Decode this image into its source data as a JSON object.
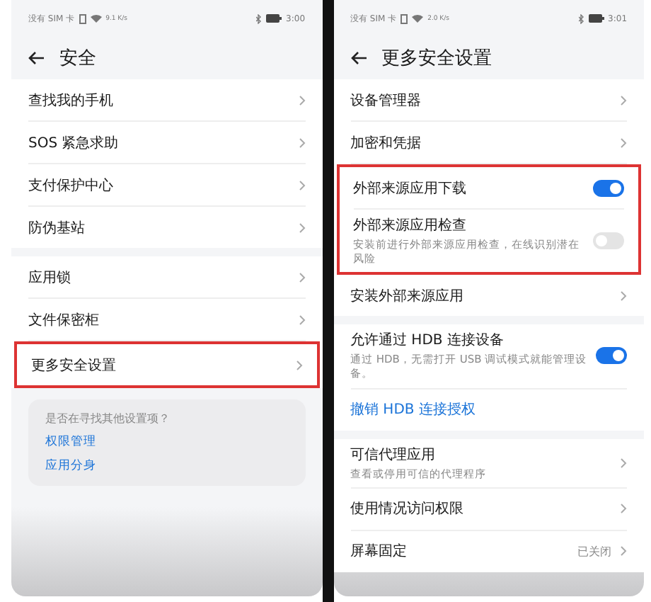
{
  "screens": [
    {
      "status": {
        "carrier": "没有 SIM 卡",
        "speed": "9.1 K/s",
        "time": "3:00"
      },
      "title": "安全",
      "groups": [
        {
          "items": [
            {
              "kind": "link",
              "label": "查找我的手机",
              "highlighted": false
            },
            {
              "kind": "link",
              "label": "SOS 紧急求助",
              "highlighted": false
            },
            {
              "kind": "link",
              "label": "支付保护中心",
              "highlighted": false
            },
            {
              "kind": "link",
              "label": "防伪基站",
              "highlighted": false
            }
          ]
        },
        {
          "items": [
            {
              "kind": "link",
              "label": "应用锁",
              "highlighted": false
            },
            {
              "kind": "link",
              "label": "文件保密柜",
              "highlighted": false
            },
            {
              "kind": "link",
              "label": "更多安全设置",
              "highlighted": true
            }
          ]
        }
      ],
      "suggestion": {
        "question": "是否在寻找其他设置项？",
        "links": [
          "权限管理",
          "应用分身"
        ]
      }
    },
    {
      "status": {
        "carrier": "没有 SIM 卡",
        "speed": "2.0 K/s",
        "time": "3:01"
      },
      "title": "更多安全设置",
      "groups": [
        {
          "items": [
            {
              "kind": "link",
              "label": "设备管理器",
              "highlighted": false
            },
            {
              "kind": "link",
              "label": "加密和凭据",
              "highlighted": false
            },
            {
              "kind": "toggle",
              "label": "外部来源应用下载",
              "on": true,
              "highlighted": true
            },
            {
              "kind": "toggle",
              "label": "外部来源应用检查",
              "subtitle": "安装前进行外部来源应用检查，在线识别潜在风险",
              "on": false,
              "highlighted": true
            },
            {
              "kind": "link",
              "label": "安装外部来源应用",
              "highlighted": false
            }
          ]
        },
        {
          "items": [
            {
              "kind": "toggle",
              "label": "允许通过 HDB 连接设备",
              "subtitle": "通过 HDB，无需打开 USB 调试模式就能管理设备。",
              "on": true,
              "highlighted": false
            },
            {
              "kind": "action",
              "label": "撤销 HDB 连接授权",
              "highlighted": false
            }
          ]
        },
        {
          "items": [
            {
              "kind": "link",
              "label": "可信代理应用",
              "subtitle": "查看或停用可信的代理程序",
              "highlighted": false
            },
            {
              "kind": "link",
              "label": "使用情况访问权限",
              "highlighted": false
            },
            {
              "kind": "link",
              "label": "屏幕固定",
              "value": "已关闭",
              "highlighted": false
            }
          ]
        }
      ]
    }
  ]
}
